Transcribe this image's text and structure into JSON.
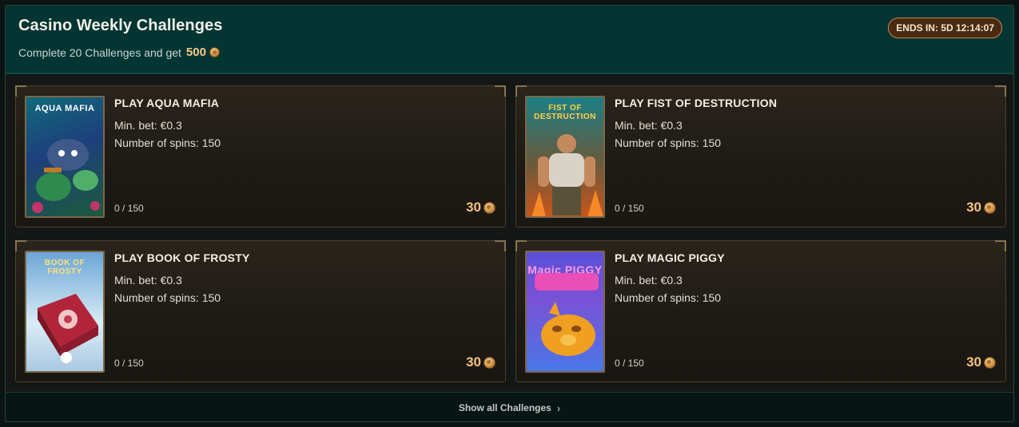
{
  "header": {
    "title": "Casino Weekly Challenges",
    "subtitle": "Complete 20 Challenges and get",
    "reward_amount": "500",
    "ends_label": "ENDS IN: 5D 12:14:07"
  },
  "challenges": [
    {
      "title": "PLAY AQUA MAFIA",
      "min_bet": "Min. bet: €0.3",
      "spins": "Number of spins: 150",
      "progress": "0 / 150",
      "reward": "30",
      "thumb_logo": "AQUA MAFIA",
      "thumb_colors": [
        "#0f6a7a",
        "#1e3f7c",
        "#1b5b3c"
      ]
    },
    {
      "title": "PLAY FIST OF DESTRUCTION",
      "min_bet": "Min. bet: €0.3",
      "spins": "Number of spins: 150",
      "progress": "0 / 150",
      "reward": "30",
      "thumb_logo": "FIST OF DESTRUCTION",
      "thumb_colors": [
        "#1c7f86",
        "#6a5a3c",
        "#c8551a"
      ]
    },
    {
      "title": "PLAY BOOK OF FROSTY",
      "min_bet": "Min. bet: €0.3",
      "spins": "Number of spins: 150",
      "progress": "0 / 150",
      "reward": "30",
      "thumb_logo": "BOOK OF FROSTY",
      "thumb_colors": [
        "#6ba6d6",
        "#d9ecf6",
        "#b2243a"
      ]
    },
    {
      "title": "PLAY MAGIC PIGGY",
      "min_bet": "Min. bet: €0.3",
      "spins": "Number of spins: 150",
      "progress": "0 / 150",
      "reward": "30",
      "thumb_logo": "Magic PIGGY",
      "thumb_colors": [
        "#5b4fd8",
        "#c83fc0",
        "#f0a021"
      ]
    }
  ],
  "footer": {
    "show_all_label": "Show all Challenges"
  },
  "icons": {
    "coin": "coin-icon",
    "chevron": "chevron-right-icon"
  }
}
